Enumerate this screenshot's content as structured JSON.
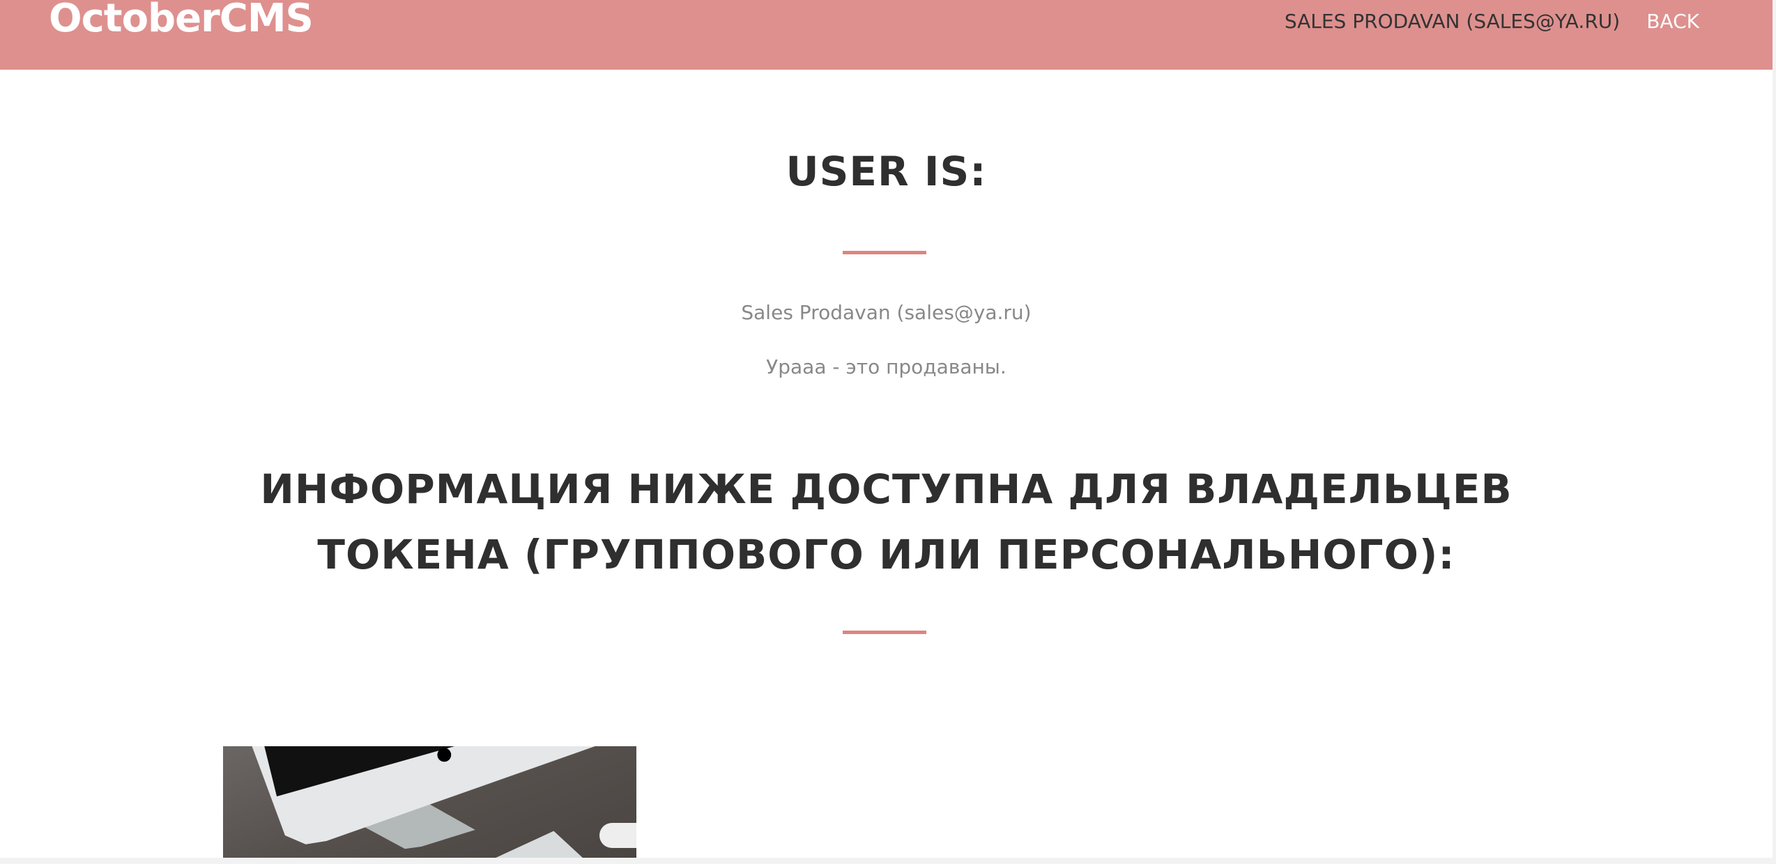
{
  "nav": {
    "brand": "OctoberCMS",
    "user": "SALES PRODAVAN (SALES@YA.RU)",
    "back": "BACK"
  },
  "main": {
    "title": "USER IS:",
    "user_line": "Sales Prodavan (sales@ya.ru)",
    "message": "Ураaa - это продаваны.",
    "heading_line1": "ИНФОРМАЦИЯ НИЖЕ ДОСТУПНА ДЛЯ ВЛАДЕЛЬЦЕВ",
    "heading_line2": "ТОКЕНА (ГРУППОВОГО ИЛИ ПЕРСОНАЛЬНОГО):"
  },
  "colors": {
    "accent": "#de908e",
    "divider": "#de8480"
  }
}
